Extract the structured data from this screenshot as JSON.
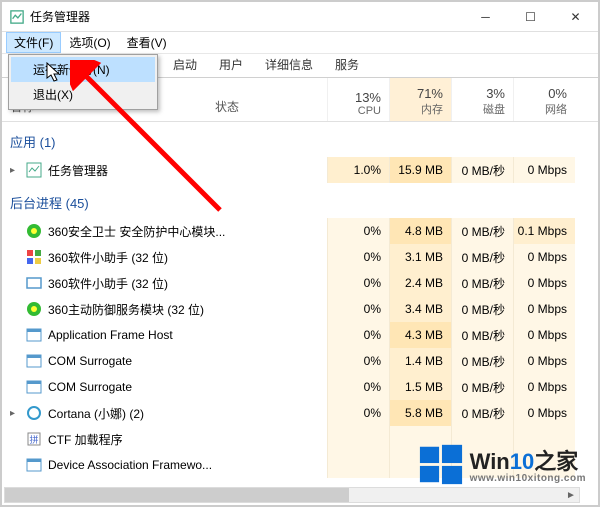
{
  "window": {
    "title": "任务管理器",
    "min_tip": "Minimize",
    "max_tip": "Maximize",
    "close_tip": "Close"
  },
  "menubar": {
    "file": "文件(F)",
    "options": "选项(O)",
    "view": "查看(V)"
  },
  "file_menu": {
    "new_task": "运行新任务(N)",
    "exit": "退出(X)"
  },
  "tabs": {
    "t2": "启动",
    "t3": "用户",
    "t4": "详细信息",
    "t5": "服务"
  },
  "columns": {
    "name": "名称",
    "status": "状态",
    "cpu_pct": "13%",
    "cpu_lbl": "CPU",
    "mem_pct": "71%",
    "mem_lbl": "内存",
    "disk_pct": "3%",
    "disk_lbl": "磁盘",
    "net_pct": "0%",
    "net_lbl": "网络"
  },
  "groups": {
    "apps": "应用 (1)",
    "bg": "后台进程 (45)"
  },
  "rows": [
    {
      "group": "apps",
      "exp": "▸",
      "icon": "tm",
      "name": "任务管理器",
      "cpu": "1.0%",
      "mem": "15.9 MB",
      "disk": "0 MB/秒",
      "net": "0 Mbps",
      "h": [
        1,
        2,
        0,
        0
      ]
    },
    {
      "group": "bg",
      "exp": "",
      "icon": "s360g",
      "name": "360安全卫士 安全防护中心模块...",
      "cpu": "0%",
      "mem": "4.8 MB",
      "disk": "0 MB/秒",
      "net": "0.1 Mbps",
      "h": [
        0,
        2,
        0,
        1
      ]
    },
    {
      "group": "bg",
      "exp": "",
      "icon": "s360c",
      "name": "360软件小助手 (32 位)",
      "cpu": "0%",
      "mem": "3.1 MB",
      "disk": "0 MB/秒",
      "net": "0 Mbps",
      "h": [
        0,
        1,
        0,
        0
      ]
    },
    {
      "group": "bg",
      "exp": "",
      "icon": "win",
      "name": "360软件小助手 (32 位)",
      "cpu": "0%",
      "mem": "2.4 MB",
      "disk": "0 MB/秒",
      "net": "0 Mbps",
      "h": [
        0,
        1,
        0,
        0
      ]
    },
    {
      "group": "bg",
      "exp": "",
      "icon": "s360g",
      "name": "360主动防御服务模块 (32 位)",
      "cpu": "0%",
      "mem": "3.4 MB",
      "disk": "0 MB/秒",
      "net": "0 Mbps",
      "h": [
        0,
        1,
        0,
        0
      ]
    },
    {
      "group": "bg",
      "exp": "",
      "icon": "app",
      "name": "Application Frame Host",
      "cpu": "0%",
      "mem": "4.3 MB",
      "disk": "0 MB/秒",
      "net": "0 Mbps",
      "h": [
        0,
        2,
        0,
        0
      ]
    },
    {
      "group": "bg",
      "exp": "",
      "icon": "app",
      "name": "COM Surrogate",
      "cpu": "0%",
      "mem": "1.4 MB",
      "disk": "0 MB/秒",
      "net": "0 Mbps",
      "h": [
        0,
        1,
        0,
        0
      ]
    },
    {
      "group": "bg",
      "exp": "",
      "icon": "app",
      "name": "COM Surrogate",
      "cpu": "0%",
      "mem": "1.5 MB",
      "disk": "0 MB/秒",
      "net": "0 Mbps",
      "h": [
        0,
        1,
        0,
        0
      ]
    },
    {
      "group": "bg",
      "exp": "▸",
      "icon": "cortana",
      "name": "Cortana (小娜) (2)",
      "cpu": "0%",
      "mem": "5.8 MB",
      "disk": "0 MB/秒",
      "net": "0 Mbps",
      "h": [
        0,
        2,
        0,
        0
      ]
    },
    {
      "group": "bg",
      "exp": "",
      "icon": "ctf",
      "name": "CTF 加载程序",
      "cpu": "",
      "mem": "",
      "disk": "",
      "net": "",
      "h": [
        0,
        0,
        0,
        0
      ]
    },
    {
      "group": "bg",
      "exp": "",
      "icon": "app",
      "name": "Device Association Framewo...",
      "cpu": "",
      "mem": "",
      "disk": "",
      "net": "",
      "h": [
        0,
        0,
        0,
        0
      ]
    }
  ],
  "watermark": {
    "brand_a": "Win",
    "brand_b": "10",
    "brand_c": "之家",
    "url": "www.win10xitong.com"
  }
}
